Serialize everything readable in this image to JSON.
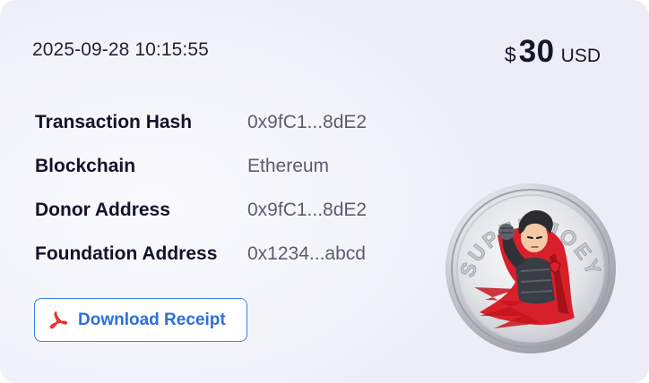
{
  "receipt": {
    "timestamp": "2025-09-28 10:15:55",
    "amount": {
      "symbol": "$",
      "value": "30",
      "unit": "USD"
    },
    "details": [
      {
        "label": "Transaction Hash",
        "value": "0x9fC1...8dE2"
      },
      {
        "label": "Blockchain",
        "value": "Ethereum"
      },
      {
        "label": "Donor Address",
        "value": "0x9fC1...8dE2"
      },
      {
        "label": "Foundation Address",
        "value": "0x1234...abcd"
      }
    ],
    "download_button": {
      "label": "Download Receipt",
      "icon": "pdf-icon"
    }
  },
  "coin": {
    "text": "SUPER JOEY",
    "icon": "super-joey-coin-icon"
  },
  "colors": {
    "accent": "#3b7fe6",
    "accent_text": "#2c6fdc",
    "pdf_icon": "#e5322d",
    "label_text": "#11142a",
    "value_text": "#5a5d6f",
    "cape": "#d8202b"
  }
}
